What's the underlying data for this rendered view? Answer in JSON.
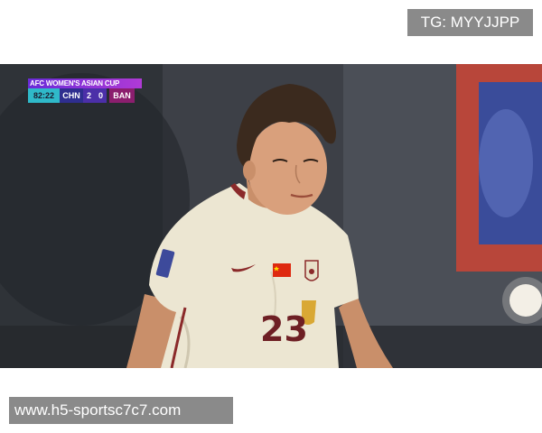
{
  "watermark_top": "TG: MYYJJPP",
  "watermark_bottom": "www.h5-sportsc7c7.com",
  "scoreboard": {
    "competition": "AFC WOMEN'S ASIAN CUP",
    "clock": "82:22",
    "home_team": "CHN",
    "home_score": "2",
    "away_score": "0",
    "away_team": "BAN"
  },
  "player": {
    "shirt_number": "23",
    "kit_color": "#ece6d2",
    "trim_color": "#8b2a2a"
  }
}
